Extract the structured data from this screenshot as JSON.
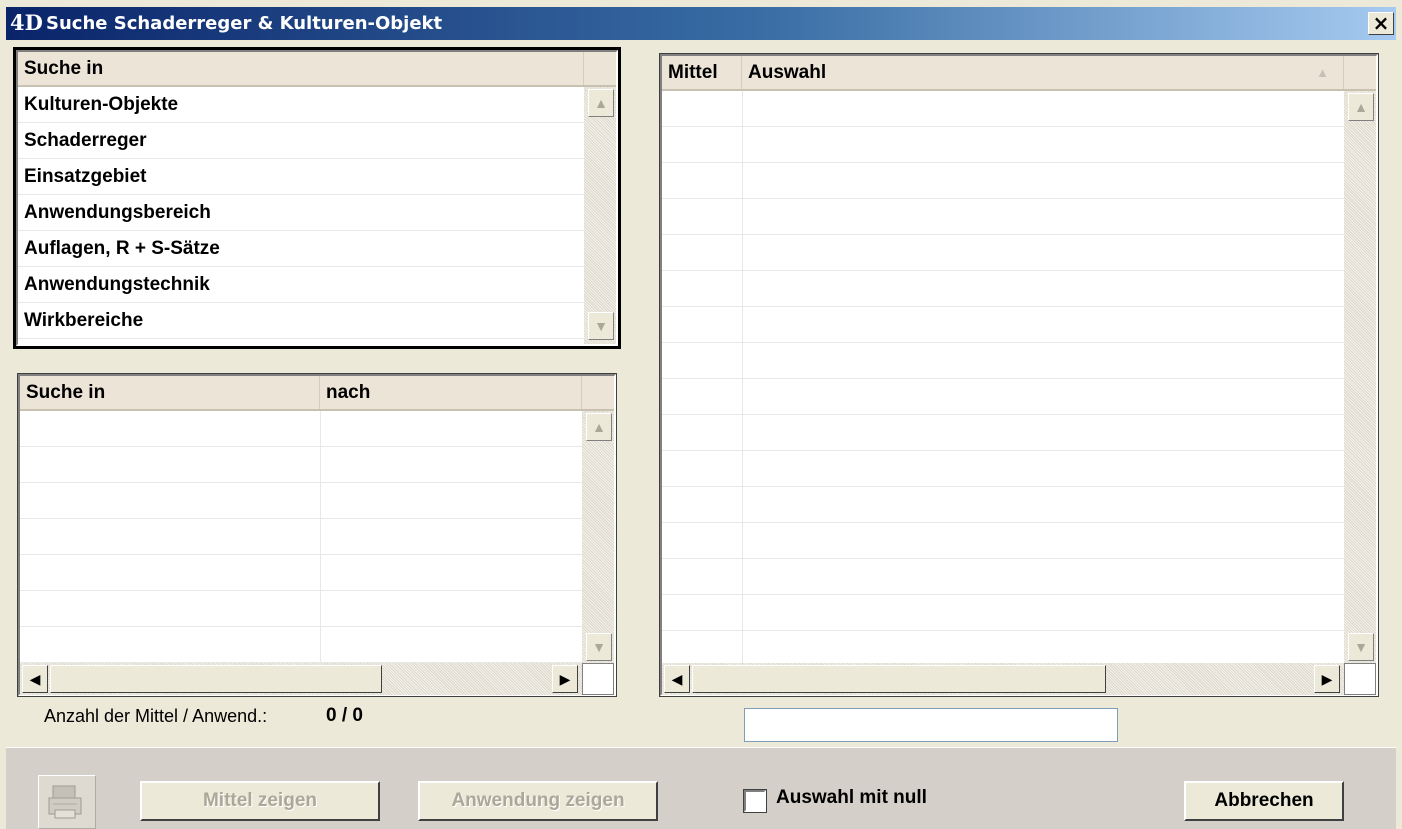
{
  "window": {
    "title": "Suche Schaderreger & Kulturen-Objekt",
    "app_icon": "4D",
    "close_glyph": "×"
  },
  "search_list": {
    "header": "Suche in",
    "items": [
      "Kulturen-Objekte",
      "Schaderreger",
      "Einsatzgebiet",
      "Anwendungsbereich",
      "Auflagen, R + S-Sätze",
      "Anwendungstechnik",
      "Wirkbereiche"
    ]
  },
  "criteria_list": {
    "columns": [
      "Suche in",
      "nach"
    ]
  },
  "results_list": {
    "columns": [
      "Mittel",
      "Auswahl"
    ]
  },
  "count": {
    "label": "Anzahl der Mittel / Anwend.:",
    "value": "0 / 0"
  },
  "search_field": {
    "value": ""
  },
  "buttons": {
    "mittel_zeigen": "Mittel zeigen",
    "anwendung_zeigen": "Anwendung zeigen",
    "abbrechen": "Abbrechen"
  },
  "checkbox": {
    "label": "Auswahl mit null",
    "checked": false
  },
  "icons": {
    "tool": "printer-icon",
    "scroll_up": "▲",
    "scroll_down": "▼",
    "scroll_left": "◀",
    "scroll_right": "▶"
  }
}
